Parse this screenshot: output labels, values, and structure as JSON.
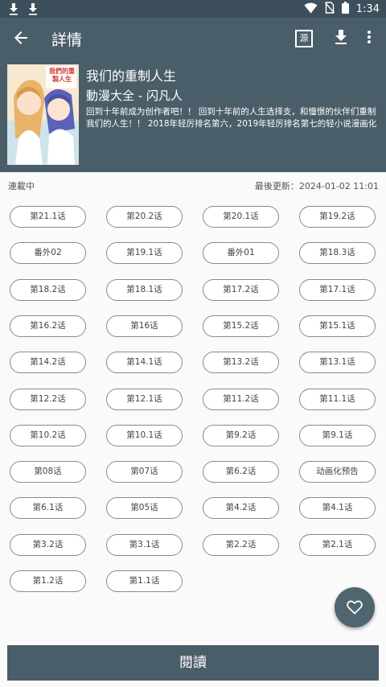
{
  "status_bar": {
    "time": "1:34"
  },
  "app_bar": {
    "title": "詳情",
    "source_icon_label": "源"
  },
  "comic": {
    "title": "我们的重制人生",
    "author_line": "動漫大全 - 闪凡人",
    "description": "回到十年前成为创作者吧！！ 回到十年前的人生选择支，和憧憬的伙伴们重制我们的人生！！ 2018年轻厉排名第六，2019年轻厉排名第七的轻小说漫画化",
    "cover_text": "我們的重製人生"
  },
  "meta": {
    "status": "連載中",
    "last_update": "最後更新：2024-01-02 11:01"
  },
  "chapters": [
    "第21.1话",
    "第20.2话",
    "第20.1话",
    "第19.2话",
    "番外02",
    "第19.1话",
    "番外01",
    "第18.3话",
    "第18.2话",
    "第18.1话",
    "第17.2话",
    "第17.1话",
    "第16.2话",
    "第16话",
    "第15.2话",
    "第15.1话",
    "第14.2话",
    "第14.1话",
    "第13.2话",
    "第13.1话",
    "第12.2话",
    "第12.1话",
    "第11.2话",
    "第11.1话",
    "第10.2话",
    "第10.1话",
    "第9.2话",
    "第9.1话",
    "第08话",
    "第07话",
    "第6.2话",
    "动画化预告",
    "第6.1话",
    "第05话",
    "第4.2话",
    "第4.1话",
    "第3.2话",
    "第3.1话",
    "第2.2话",
    "第2.1话",
    "第1.2话",
    "第1.1话"
  ],
  "read_button": "閱讀",
  "colors": {
    "primary": "#4a5e69",
    "status_bar": "#3d4f5a",
    "fab": "#4f6570"
  }
}
